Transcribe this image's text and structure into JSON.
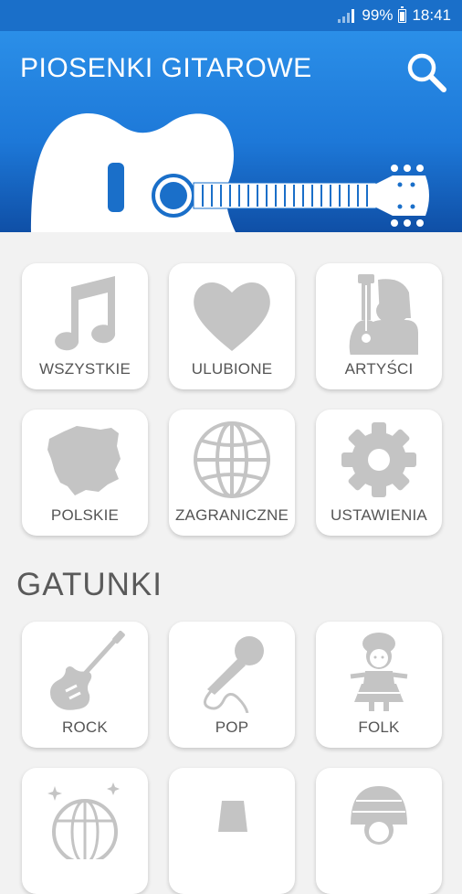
{
  "status_bar": {
    "battery": "99%",
    "time": "18:41"
  },
  "header": {
    "title": "PIOSENKI GITAROWE",
    "search_icon": "search-icon"
  },
  "menu": [
    {
      "label": "WSZYSTKIE",
      "icon": "music-note-icon"
    },
    {
      "label": "ULUBIONE",
      "icon": "heart-icon"
    },
    {
      "label": "ARTYŚCI",
      "icon": "artist-icon"
    },
    {
      "label": "POLSKIE",
      "icon": "poland-map-icon"
    },
    {
      "label": "ZAGRANICZNE",
      "icon": "globe-icon"
    },
    {
      "label": "USTAWIENIA",
      "icon": "gear-icon"
    }
  ],
  "genres_title": "GATUNKI",
  "genres": [
    {
      "label": "ROCK",
      "icon": "electric-guitar-icon"
    },
    {
      "label": "POP",
      "icon": "microphone-icon"
    },
    {
      "label": "FOLK",
      "icon": "folk-doll-icon"
    },
    {
      "label": "",
      "icon": "disco-ball-icon"
    },
    {
      "label": "",
      "icon": "genre-icon"
    },
    {
      "label": "",
      "icon": "genre-icon"
    }
  ],
  "colors": {
    "primary": "#1d78d8",
    "status_bar": "#1a6fc9",
    "icon_gray": "#c4c4c4",
    "background": "#f2f2f2"
  }
}
